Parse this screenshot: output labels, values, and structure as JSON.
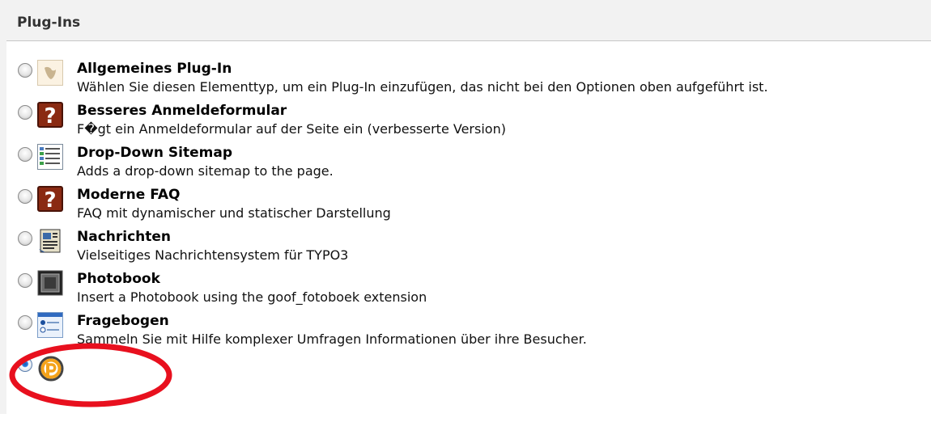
{
  "section": {
    "title": "Plug-Ins"
  },
  "plugins": [
    {
      "title": "Allgemeines Plug-In",
      "description": "Wählen Sie diesen Elementtyp, um ein Plug-In einzufügen, das nicht bei den Optionen oben aufgeführt ist.",
      "icon": "typo3-logo-icon",
      "selected": false
    },
    {
      "title": "Besseres Anmeldeformular",
      "description": "F�gt ein Anmeldeformular auf der Seite ein (verbesserte Version)",
      "icon": "question-mark-icon",
      "selected": false
    },
    {
      "title": "Drop-Down Sitemap",
      "description": "Adds a drop-down sitemap to the page.",
      "icon": "sitemap-list-icon",
      "selected": false
    },
    {
      "title": "Moderne FAQ",
      "description": "FAQ mit dynamischer und statischer Darstellung",
      "icon": "question-mark-icon",
      "selected": false
    },
    {
      "title": "Nachrichten",
      "description": "Vielseitiges Nachrichtensystem für TYPO3",
      "icon": "news-icon",
      "selected": false
    },
    {
      "title": "Photobook",
      "description": "Insert a Photobook using the goof_fotoboek extension",
      "icon": "photo-frame-icon",
      "selected": false
    },
    {
      "title": "Fragebogen",
      "description": "Sammeln Sie mit Hilfe komplexer Umfragen Informationen über ihre Besucher.",
      "icon": "form-window-icon",
      "selected": false
    },
    {
      "title": "",
      "description": "",
      "icon": "p-logo-icon",
      "selected": true
    }
  ],
  "colors": {
    "annotation": "#e8101e",
    "header_bg": "#f2f2f2",
    "p_logo": "#f4a21a"
  }
}
